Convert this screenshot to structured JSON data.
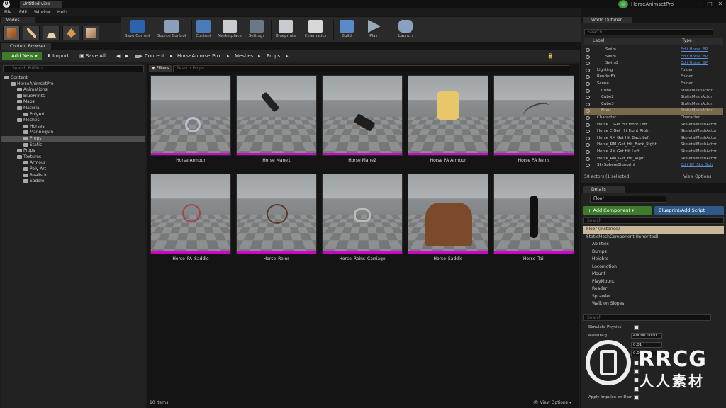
{
  "app": {
    "tab_title": "Untitled view",
    "project_name": "HorseAnimsetPro"
  },
  "menu": [
    "File",
    "Edit",
    "Window",
    "Help"
  ],
  "modes": {
    "tab_label": "Modes"
  },
  "toolbar": [
    {
      "label": "Save Current",
      "icon": "save-icon"
    },
    {
      "label": "Source Control",
      "icon": "source-control-icon"
    },
    {
      "label": "Content",
      "icon": "content-icon"
    },
    {
      "label": "Marketplace",
      "icon": "marketplace-icon"
    },
    {
      "label": "Settings",
      "icon": "settings-icon"
    },
    {
      "label": "Blueprints",
      "icon": "blueprints-icon"
    },
    {
      "label": "Cinematics",
      "icon": "cinematics-icon"
    },
    {
      "label": "Build",
      "icon": "build-icon"
    },
    {
      "label": "Play",
      "icon": "play-icon"
    },
    {
      "label": "Launch",
      "icon": "launch-icon"
    }
  ],
  "content_browser": {
    "tab_label": "Content Browser",
    "add_new": "Add New",
    "import": "Import",
    "save_all": "Save All",
    "breadcrumb": [
      "Content",
      "HorseAnimsetPro",
      "Meshes",
      "Props"
    ],
    "folder_search_placeholder": "Search Folders",
    "filters": "Filters",
    "asset_search_placeholder": "Search Props",
    "items_count": "10 items",
    "view_options": "View Options"
  },
  "folders": [
    {
      "label": "Content",
      "level": 0
    },
    {
      "label": "HorseAnimsetPro",
      "level": 1
    },
    {
      "label": "Animations",
      "level": 2
    },
    {
      "label": "BluePrints",
      "level": 2
    },
    {
      "label": "Maps",
      "level": 2
    },
    {
      "label": "Material",
      "level": 2
    },
    {
      "label": "PolyArt",
      "level": 3
    },
    {
      "label": "Meshes",
      "level": 2
    },
    {
      "label": "Horses",
      "level": 3
    },
    {
      "label": "Mannequin",
      "level": 3
    },
    {
      "label": "Props",
      "level": 3,
      "selected": true
    },
    {
      "label": "Static",
      "level": 3
    },
    {
      "label": "Props",
      "level": 2
    },
    {
      "label": "Textures",
      "level": 2
    },
    {
      "label": "Armour",
      "level": 3
    },
    {
      "label": "Poly Art",
      "level": 3
    },
    {
      "label": "Realistic",
      "level": 3
    },
    {
      "label": "Saddle",
      "level": 3
    }
  ],
  "assets": [
    {
      "label": "Horse Armour"
    },
    {
      "label": "Horse Mane1"
    },
    {
      "label": "Horse Mane2"
    },
    {
      "label": "Horse PA Armour"
    },
    {
      "label": "Horse PA Reins"
    },
    {
      "label": "Horse_PA_Saddle"
    },
    {
      "label": "Horse_Reins"
    },
    {
      "label": "Horse_Reins_Carriage"
    },
    {
      "label": "Horse_Saddle"
    },
    {
      "label": "Horse_Tail"
    }
  ],
  "world_outliner": {
    "tab_label": "World Outliner",
    "search_placeholder": "Search",
    "col_label": "Label",
    "col_type": "Type",
    "rows": [
      {
        "label": "Swim",
        "type": "Edit Horse_BP",
        "link": true,
        "indent": 3
      },
      {
        "label": "Swim",
        "type": "Edit Horse_BP",
        "link": true,
        "indent": 3
      },
      {
        "label": "Swim2",
        "type": "Edit Horse_BP",
        "link": true,
        "indent": 3
      },
      {
        "label": "Lighting",
        "type": "Folder",
        "link": false,
        "indent": 1
      },
      {
        "label": "RenderFX",
        "type": "Folder",
        "link": false,
        "indent": 1
      },
      {
        "label": "Scene",
        "type": "Folder",
        "link": false,
        "indent": 1
      },
      {
        "label": "Cube",
        "type": "StaticMeshActor",
        "link": false,
        "indent": 2
      },
      {
        "label": "Cube2",
        "type": "StaticMeshActor",
        "link": false,
        "indent": 2
      },
      {
        "label": "Cube3",
        "type": "StaticMeshActor",
        "link": false,
        "indent": 2
      },
      {
        "label": "Floor",
        "type": "StaticMeshActor",
        "link": false,
        "indent": 2,
        "selected": true
      },
      {
        "label": "Character",
        "type": "Character",
        "link": false,
        "indent": 1
      },
      {
        "label": "Horse C Get Hit Front Left",
        "type": "SkeletalMeshActor",
        "link": false,
        "indent": 1
      },
      {
        "label": "Horse C Get Hit Front Right",
        "type": "SkeletalMeshActor",
        "link": false,
        "indent": 1
      },
      {
        "label": "Horse RM Get Hit Back Left",
        "type": "SkeletalMeshActor",
        "link": false,
        "indent": 1
      },
      {
        "label": "Horse_RM_Get_Hit_Back_Right",
        "type": "SkeletalMeshActor",
        "link": false,
        "indent": 1
      },
      {
        "label": "Horse RM Get Hit Left",
        "type": "SkeletalMeshActor",
        "link": false,
        "indent": 1
      },
      {
        "label": "Horse_RM_Get_Hit_Right",
        "type": "SkeletalMeshActor",
        "link": false,
        "indent": 1
      },
      {
        "label": "SkySphereBlueprint",
        "type": "Edit BP_Sky_Sph",
        "link": true,
        "indent": 1
      }
    ],
    "footer": "58 actors (1 selected)",
    "view_options": "View Options"
  },
  "details": {
    "tab_label": "Details",
    "name_value": "Floor",
    "add_component": "+ Add Component",
    "blueprint_script": "Blueprint/Add Script",
    "comp_search_placeholder": "Search",
    "components": [
      {
        "label": "Floor (Instance)",
        "selected": true
      },
      {
        "label": "StaticMeshComponent (Inherited)"
      },
      {
        "label": "Abilities"
      },
      {
        "label": "Bumps"
      },
      {
        "label": "Heights"
      },
      {
        "label": "Locomotion"
      },
      {
        "label": "Mount"
      },
      {
        "label": "PlayMount"
      },
      {
        "label": "Reader"
      },
      {
        "label": "Sprawler"
      },
      {
        "label": "Walk on Slopes"
      }
    ],
    "prop_search_placeholder": "Search",
    "properties": [
      {
        "label": "Simulate Physics",
        "kind": "checkbox"
      },
      {
        "label": "MassInKg",
        "kind": "number",
        "value": "40000.0000"
      },
      {
        "label": "",
        "kind": "number",
        "value": "0.01"
      },
      {
        "label": "",
        "kind": "number",
        "value": "0.0"
      },
      {
        "label": "",
        "kind": "checkbox"
      },
      {
        "label": "",
        "kind": "checkbox"
      },
      {
        "label": "",
        "kind": "checkbox"
      },
      {
        "label": "",
        "kind": "checkbox"
      },
      {
        "label": "Apply Impulse on Dam",
        "kind": "checkbox"
      }
    ]
  },
  "watermark": {
    "brand": "RRCG",
    "subtitle": "人人素材"
  }
}
